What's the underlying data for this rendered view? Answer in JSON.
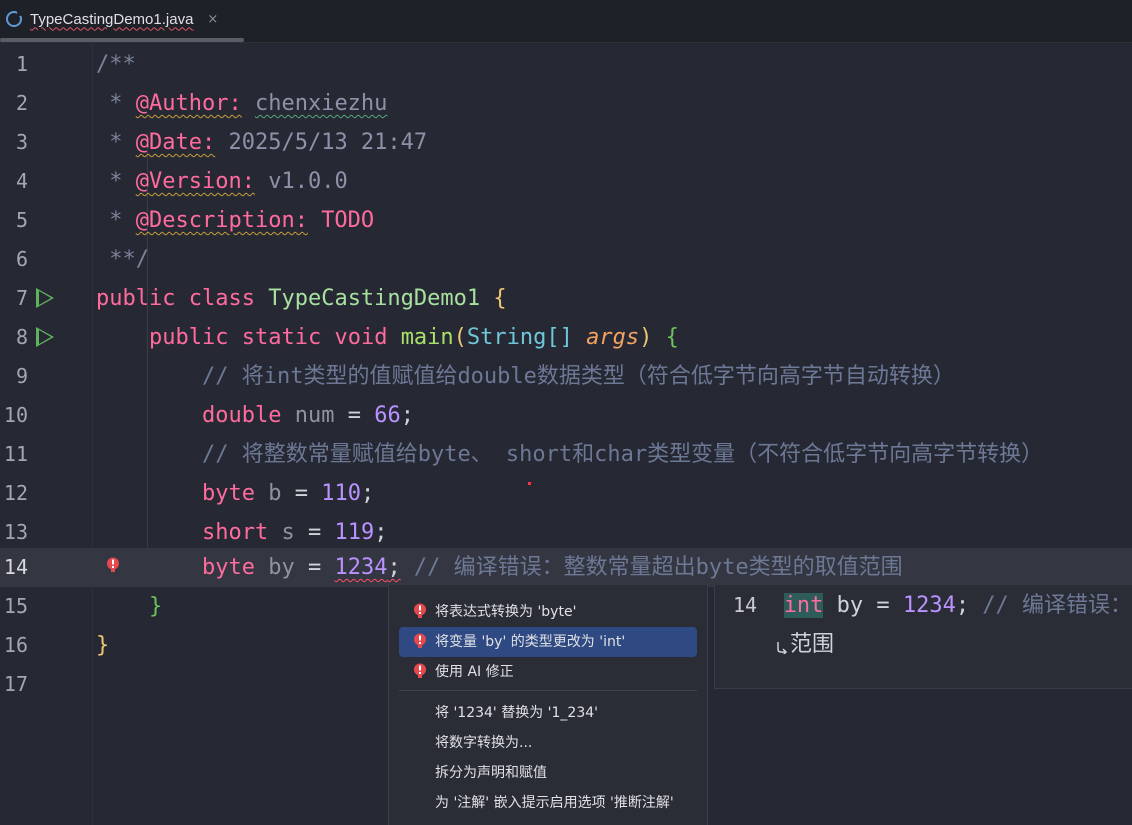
{
  "tab": {
    "title": "TypeCastingDemo1.java",
    "close": "×",
    "icon": "java-class-icon"
  },
  "lines": {
    "l1": {
      "n": "1",
      "t": "/**"
    },
    "l2": {
      "n": "2",
      "star": " * ",
      "tag": "@Author:",
      "val": "chenxiezhu"
    },
    "l3": {
      "n": "3",
      "star": " * ",
      "tag": "@Date:",
      "val": "2025/5/13 21:47"
    },
    "l4": {
      "n": "4",
      "star": " * ",
      "tag": "@Version:",
      "val": "v1.0.0"
    },
    "l5": {
      "n": "5",
      "star": " * ",
      "tag": "@Description:",
      "val": "TODO"
    },
    "l6": {
      "n": "6",
      "t": " **/"
    },
    "l7": {
      "n": "7",
      "kw1": "public",
      "kw2": "class",
      "cls": "TypeCastingDemo1",
      "brace": "{"
    },
    "l8": {
      "n": "8",
      "indent": "    ",
      "kw1": "public",
      "kw2": "static",
      "kw3": "void",
      "fn": "main",
      "lp": "(",
      "type": "String[]",
      "param": "args",
      "rp": ")",
      "brace": "{"
    },
    "l9": {
      "n": "9",
      "indent": "        ",
      "cmt": "// 将int类型的值赋值给double数据类型（符合低字节向高字节自动转换）"
    },
    "l10": {
      "n": "10",
      "indent": "        ",
      "kw": "double",
      "var": "num",
      "eq": " = ",
      "num": "66",
      "semi": ";"
    },
    "l11": {
      "n": "11",
      "indent": "        ",
      "cmt": "// 将整数常量赋值给byte、 short和char类型变量（不符合低字节向高字节转换）"
    },
    "l12": {
      "n": "12",
      "indent": "        ",
      "kw": "byte",
      "var": "b",
      "eq": " = ",
      "num": "110",
      "semi": ";"
    },
    "l13": {
      "n": "13",
      "indent": "        ",
      "kw": "short",
      "var": "s",
      "eq": " = ",
      "num": "119",
      "semi": ";"
    },
    "l14": {
      "n": "14",
      "indent": "        ",
      "kw": "byte",
      "var": "by",
      "eq": " = ",
      "num": "1234",
      "semi": ";",
      "cmt": " // 编译错误：整数常量超出byte类型的取值范围"
    },
    "l15": {
      "n": "15",
      "indent": "    ",
      "brace": "}"
    },
    "l16": {
      "n": "16",
      "brace": "}"
    },
    "l17": {
      "n": "17"
    }
  },
  "popup": {
    "items": [
      {
        "label": "将表达式转换为 'byte'"
      },
      {
        "label": "将变量 'by' 的类型更改为 'int'"
      },
      {
        "label": "使用 AI 修正"
      },
      {
        "label": "将 '1234' 替换为 '1_234'"
      },
      {
        "label": "将数字转换为..."
      },
      {
        "label": "拆分为声明和赋值"
      },
      {
        "label": "为 '注解' 嵌入提示启用选项 '推断注解'"
      }
    ]
  },
  "preview": {
    "ln": "14",
    "kw": "int",
    "rest": " by = ",
    "num": "1234",
    "semi": ";",
    "cmt": " // 编译错误：",
    "cont": "范围"
  },
  "colors": {
    "accent": "#2f4a82",
    "error": "#ff5060",
    "run": "#5fb35a"
  }
}
